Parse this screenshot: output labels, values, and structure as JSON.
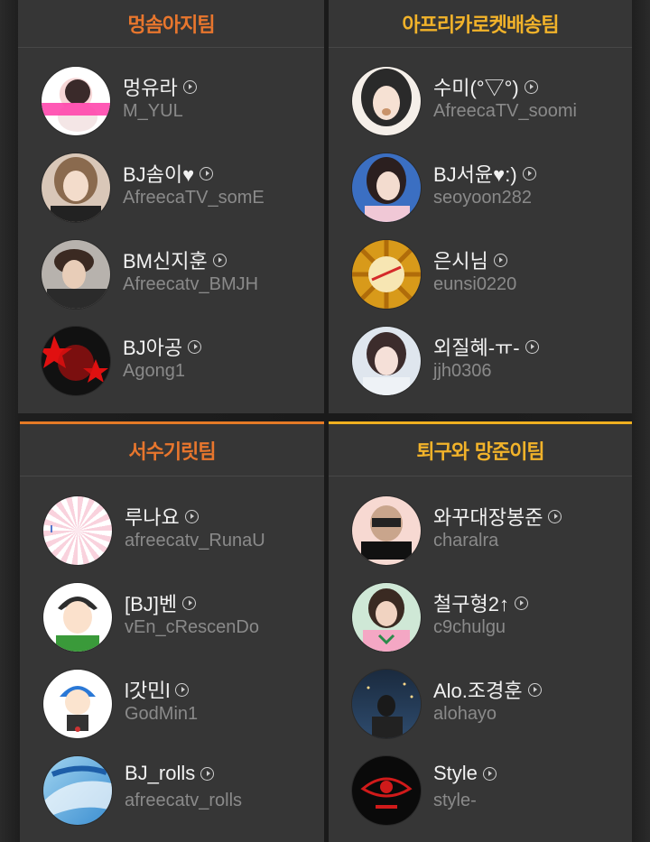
{
  "colors": {
    "orange": "#e8762d",
    "gold": "#f2b32a"
  },
  "teams": [
    {
      "name": "멍솜아지팀",
      "color": "orange",
      "members": [
        {
          "name": "멍유라",
          "id": "M_YUL"
        },
        {
          "name": "BJ솜이♥",
          "id": "AfreecaTV_somE"
        },
        {
          "name": "BM신지훈",
          "id": "Afreecatv_BMJH"
        },
        {
          "name": "BJ아공",
          "id": "Agong1"
        }
      ]
    },
    {
      "name": "아프리카로켓배송팀",
      "color": "gold",
      "members": [
        {
          "name": "수미(°▽°)",
          "id": "AfreecaTV_soomi"
        },
        {
          "name": "BJ서윤♥:)",
          "id": "seoyoon282"
        },
        {
          "name": "은시님",
          "id": "eunsi0220"
        },
        {
          "name": "외질혜-ㅠ-",
          "id": "jjh0306"
        }
      ]
    },
    {
      "name": "서수기릿팀",
      "color": "orange",
      "members": [
        {
          "name": "루나요",
          "id": "afreecatv_RunaU"
        },
        {
          "name": "[BJ]벤",
          "id": "vEn_cRescenDo"
        },
        {
          "name": "l갓민l",
          "id": "GodMin1"
        },
        {
          "name": "BJ_rolls",
          "id": "afreecatv_rolls"
        }
      ]
    },
    {
      "name": "퇴구와 망준이팀",
      "color": "gold",
      "members": [
        {
          "name": "와꾸대장봉준",
          "id": "charalra"
        },
        {
          "name": "철구형2↑",
          "id": "c9chulgu"
        },
        {
          "name": "Alo.조경훈",
          "id": "alohayo"
        },
        {
          "name": "Style",
          "id": "style-"
        }
      ]
    }
  ]
}
